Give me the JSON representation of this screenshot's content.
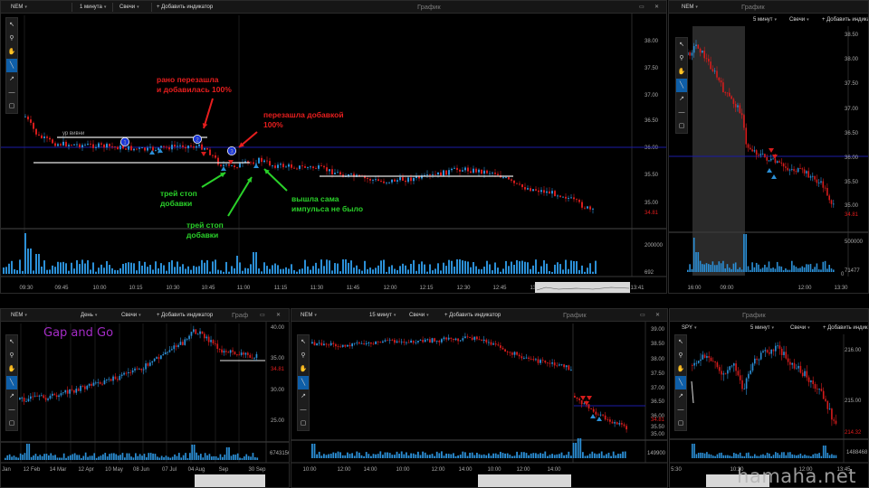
{
  "colors": {
    "up": "#2b8fd6",
    "down": "#d61c1c",
    "bg": "#000000",
    "level": "#1b1ba8",
    "accent": "#0e5ea8",
    "green": "#2ad12a",
    "red": "#e81e1e"
  },
  "toolbar": {
    "tools": [
      "cursor-icon",
      "zoom-icon",
      "hand-icon",
      "trendline-icon",
      "ray-icon",
      "hline-icon",
      "rect-icon"
    ]
  },
  "panels": {
    "main": {
      "ticker": "NEM",
      "interval": "1 минута",
      "type": "Свечи",
      "add_indicator": "+ Добавить индикатор",
      "title": "График",
      "price_ticks": [
        "38.00",
        "37.50",
        "37.00",
        "36.50",
        "36.00",
        "35.50",
        "35.00"
      ],
      "current_price": "34.81",
      "volume_ticks": [
        "200000"
      ],
      "volume_current": "692",
      "time_ticks": [
        "09:30",
        "09:45",
        "10:00",
        "10:15",
        "10:30",
        "10:45",
        "11:00",
        "11:15",
        "11:30",
        "11:45",
        "12:00",
        "12:15",
        "12:30",
        "12:45",
        "13:00",
        "13:15",
        "13:30",
        "13:41"
      ],
      "level_label": "ур вивни",
      "markers": [
        "1",
        "2",
        "3"
      ],
      "annotations": {
        "early": "рано перезашла\nи добавилась 100%",
        "late": "перезашла добавкой\n100%",
        "stop1": "трей стоп\nдобавки",
        "stop2": "трей стоп\nдобавки",
        "self": "вышла сама\nимпульса не было"
      }
    },
    "top_right": {
      "ticker": "NEM",
      "interval": "5 минут",
      "type": "Свечи",
      "add_indicator": "+ Добавить индикатор",
      "title": "График",
      "price_ticks": [
        "38.50",
        "38.00",
        "37.50",
        "37.00",
        "36.50",
        "36.00",
        "35.50",
        "35.00"
      ],
      "current_price": "34.81",
      "volume_ticks": [
        "500000",
        "0"
      ],
      "volume_current": "71477",
      "time_ticks": [
        "16:00",
        "09:00",
        "12:00",
        "13:30"
      ]
    },
    "bottom_left": {
      "ticker": "NEM",
      "interval": "День",
      "type": "Свечи",
      "add_indicator": "+ Добавить индикатор",
      "title": "Граф",
      "overlay_label": "Gap and Go",
      "price_ticks": [
        "40.00",
        "35.00",
        "30.00",
        "25.00"
      ],
      "current_price": "34.81",
      "volume_current": "6743156",
      "time_ticks": [
        "Jan",
        "12 Feb",
        "14 Mar",
        "12 Apr",
        "10 May",
        "08 Jun",
        "07 Jul",
        "04 Aug",
        "Sep",
        "30 Sep"
      ]
    },
    "bottom_mid": {
      "ticker": "NEM",
      "interval": "15 минут",
      "type": "Свечи",
      "add_indicator": "+ Добавить индикатор",
      "title": "График",
      "price_ticks": [
        "39.00",
        "38.50",
        "38.00",
        "37.50",
        "37.00",
        "36.50",
        "36.00",
        "35.50",
        "35.00"
      ],
      "current_price": "34.81",
      "volume_current": "149900",
      "time_ticks": [
        "10:00",
        "12:00",
        "14:00",
        "10:00",
        "12:00",
        "14:00",
        "10:00",
        "12:00",
        "14:00"
      ]
    },
    "bottom_right": {
      "ticker": "SPY",
      "interval": "5 минут",
      "type": "Свечи",
      "add_indicator": "+ Добавить индикатор",
      "title": "График",
      "price_ticks": [
        "216.00",
        "215.00"
      ],
      "current_price": "214.32",
      "volume_current": "1488468",
      "time_ticks": [
        "5:30",
        "10:30",
        "12:00",
        "13:45"
      ]
    }
  },
  "watermark": "hamaha.net"
}
